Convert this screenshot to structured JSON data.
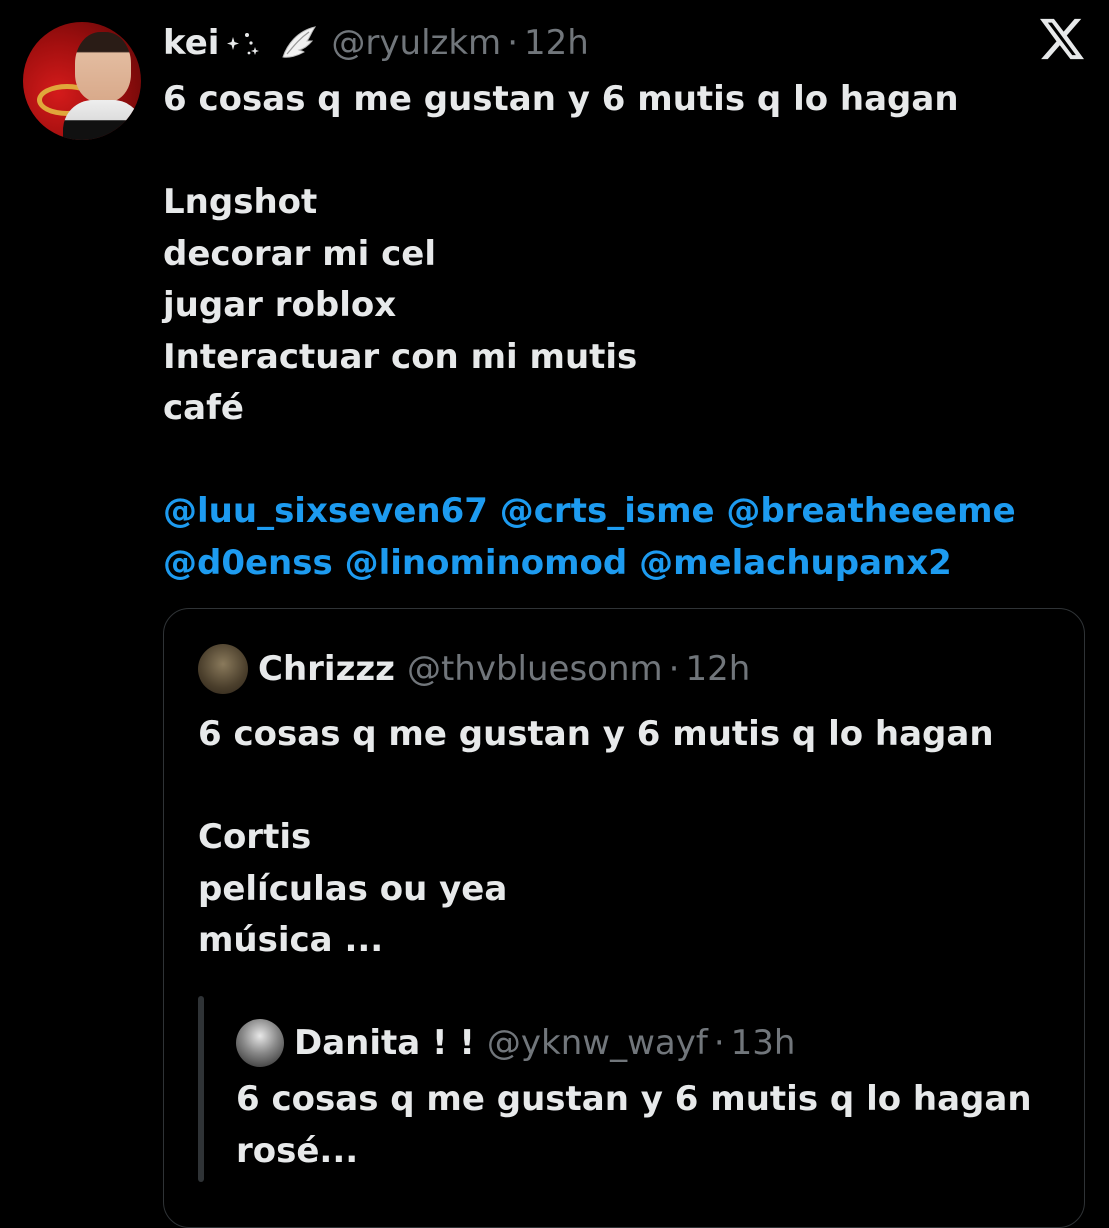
{
  "tweet": {
    "author_name": "kei",
    "author_handle": "@ryulzkm",
    "separator": "·",
    "time": "12h",
    "text": "6 cosas q me gustan y 6 mutis q lo hagan\n\nLngshot\ndecorar mi cel\njugar roblox\nInteractuar con mi mutis\ncafé",
    "mentions_line1": [
      "@luu_sixseven67",
      "@crts_isme",
      "@breatheeeme"
    ],
    "mentions_line2": [
      "@d0enss",
      "@linominomod",
      "@melachupanx2"
    ],
    "icons": [
      "sparkle-icon",
      "wing-icon",
      "x-logo-icon"
    ]
  },
  "quote": {
    "author_name": "Chrizzz",
    "author_handle": "@thvbluesonm",
    "separator": "·",
    "time": "12h",
    "text": "6 cosas q me gustan y 6 mutis q lo hagan\n\nCortis\npelículas ou yea\nmúsica ..."
  },
  "nested_quote": {
    "author_name": "Danita ! !",
    "author_handle": "@yknw_wayf",
    "separator": "·",
    "time": "13h",
    "text": "6 cosas q me gustan y 6 mutis q lo hagan\nrosé..."
  },
  "colors": {
    "background": "#000000",
    "text": "#e7e9ea",
    "secondary": "#71767b",
    "link": "#1d9bf0",
    "border": "#2f3336"
  }
}
